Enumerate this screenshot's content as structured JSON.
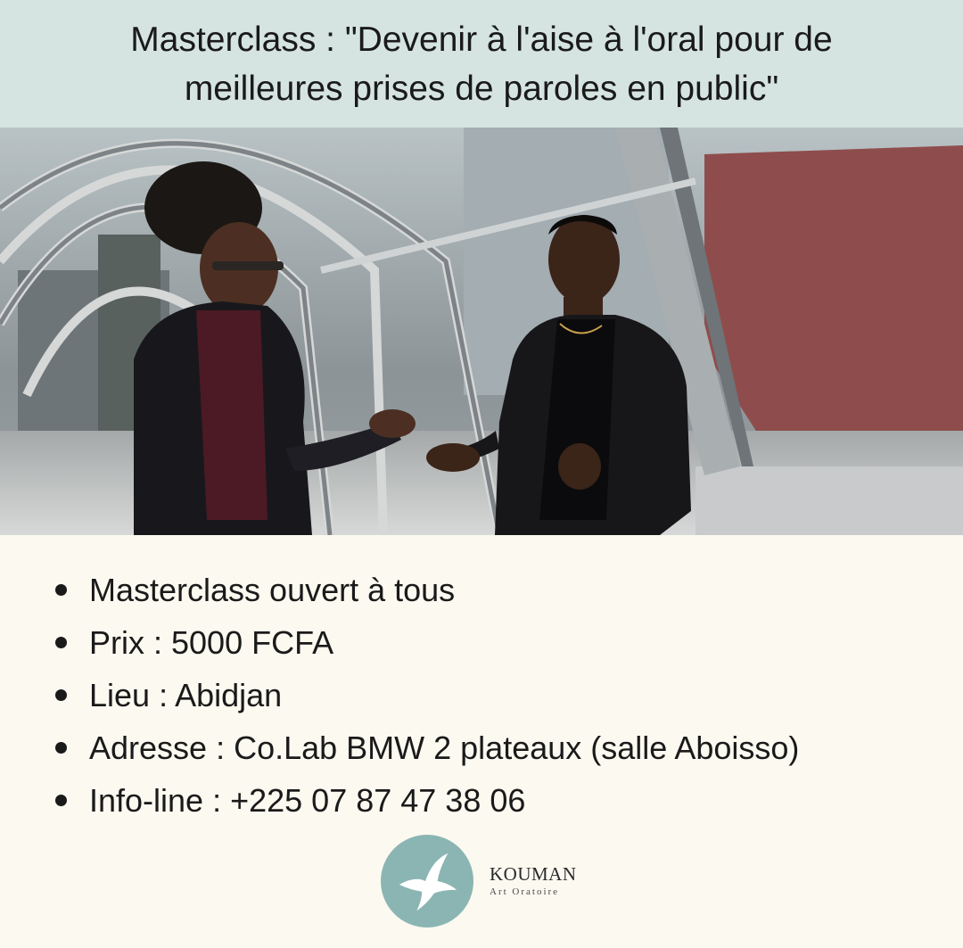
{
  "header": {
    "title": "Masterclass : \"Devenir à l'aise à l'oral pour de\nmeilleures prises de paroles en public\""
  },
  "details": {
    "items": [
      "Masterclass ouvert à tous",
      "Prix : 5000 FCFA",
      "Lieu : Abidjan",
      "Adresse : Co.Lab BMW 2 plateaux (salle Aboisso)",
      "Info-line : +225 07 87 47 38 06"
    ]
  },
  "logo": {
    "brand": "KOUMAN",
    "tagline": "Art Oratoire"
  },
  "colors": {
    "header_bg": "#d5e4e1",
    "page_bg": "#fbf9f0",
    "logo_circle": "#8ab5b3",
    "text": "#1a1a1a"
  }
}
